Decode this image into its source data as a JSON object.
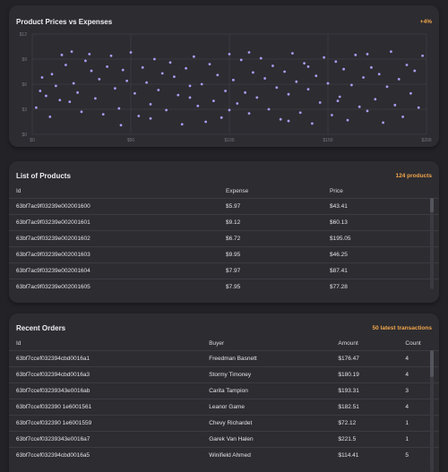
{
  "chart_card": {
    "title": "Product Prices vs Expenses",
    "badge": "+4%"
  },
  "chart_data": {
    "type": "scatter",
    "title": "Product Prices vs Expenses",
    "xlabel": "",
    "ylabel": "",
    "xlim": [
      0,
      200
    ],
    "ylim": [
      0,
      12
    ],
    "x_ticks": [
      "$0",
      "$50",
      "$100",
      "$150",
      "$200"
    ],
    "y_ticks": [
      "$0",
      "$3",
      "$6",
      "$9",
      "$12"
    ],
    "point_color": "#a99cf0",
    "grid": true,
    "points": [
      [
        2,
        3.2
      ],
      [
        4,
        5.2
      ],
      [
        5,
        6.8
      ],
      [
        7,
        4.6
      ],
      [
        9,
        2.1
      ],
      [
        10,
        7.2
      ],
      [
        12,
        5.8
      ],
      [
        14,
        4.1
      ],
      [
        15,
        9.5
      ],
      [
        17,
        8.3
      ],
      [
        19,
        3.9
      ],
      [
        21,
        6.1
      ],
      [
        23,
        5.0
      ],
      [
        25,
        2.7
      ],
      [
        27,
        8.8
      ],
      [
        29,
        9.6
      ],
      [
        30,
        7.6
      ],
      [
        32,
        4.3
      ],
      [
        34,
        6.6
      ],
      [
        36,
        2.4
      ],
      [
        38,
        8.1
      ],
      [
        40,
        9.4
      ],
      [
        42,
        5.5
      ],
      [
        44,
        3.1
      ],
      [
        46,
        7.7
      ],
      [
        48,
        6.4
      ],
      [
        50,
        9.8
      ],
      [
        52,
        4.9
      ],
      [
        54,
        2.2
      ],
      [
        56,
        8.0
      ],
      [
        58,
        6.2
      ],
      [
        60,
        3.6
      ],
      [
        62,
        9.0
      ],
      [
        64,
        5.3
      ],
      [
        66,
        7.3
      ],
      [
        68,
        2.9
      ],
      [
        70,
        8.6
      ],
      [
        72,
        6.9
      ],
      [
        74,
        4.7
      ],
      [
        76,
        1.2
      ],
      [
        78,
        7.9
      ],
      [
        80,
        5.8
      ],
      [
        82,
        9.3
      ],
      [
        84,
        3.4
      ],
      [
        86,
        6.0
      ],
      [
        88,
        1.5
      ],
      [
        90,
        8.4
      ],
      [
        92,
        4.0
      ],
      [
        94,
        7.1
      ],
      [
        96,
        2.0
      ],
      [
        98,
        5.2
      ],
      [
        100,
        9.6
      ],
      [
        102,
        6.5
      ],
      [
        104,
        3.7
      ],
      [
        106,
        8.9
      ],
      [
        108,
        5.0
      ],
      [
        110,
        2.5
      ],
      [
        112,
        7.4
      ],
      [
        114,
        4.4
      ],
      [
        116,
        9.1
      ],
      [
        118,
        6.7
      ],
      [
        120,
        3.0
      ],
      [
        122,
        8.2
      ],
      [
        124,
        5.6
      ],
      [
        126,
        1.8
      ],
      [
        128,
        7.5
      ],
      [
        130,
        4.8
      ],
      [
        132,
        9.7
      ],
      [
        134,
        6.3
      ],
      [
        136,
        2.6
      ],
      [
        138,
        8.5
      ],
      [
        140,
        5.4
      ],
      [
        142,
        1.3
      ],
      [
        144,
        7.0
      ],
      [
        146,
        3.8
      ],
      [
        148,
        9.2
      ],
      [
        150,
        6.1
      ],
      [
        152,
        2.3
      ],
      [
        154,
        8.7
      ],
      [
        156,
        4.5
      ],
      [
        158,
        7.8
      ],
      [
        160,
        1.7
      ],
      [
        162,
        5.9
      ],
      [
        164,
        9.5
      ],
      [
        166,
        3.3
      ],
      [
        168,
        6.8
      ],
      [
        170,
        2.8
      ],
      [
        172,
        8.0
      ],
      [
        174,
        4.2
      ],
      [
        176,
        7.2
      ],
      [
        178,
        1.4
      ],
      [
        180,
        5.7
      ],
      [
        182,
        9.9
      ],
      [
        184,
        3.5
      ],
      [
        186,
        6.6
      ],
      [
        188,
        2.1
      ],
      [
        190,
        8.3
      ],
      [
        192,
        4.9
      ],
      [
        194,
        7.6
      ],
      [
        196,
        3.2
      ],
      [
        198,
        9.4
      ],
      [
        20,
        9.9
      ],
      [
        60,
        1.9
      ],
      [
        110,
        9.8
      ],
      [
        130,
        1.6
      ],
      [
        170,
        9.6
      ],
      [
        80,
        4.4
      ],
      [
        140,
        8.1
      ],
      [
        100,
        2.9
      ],
      [
        45,
        1.1
      ],
      [
        155,
        4.0
      ]
    ]
  },
  "products": {
    "title": "List of Products",
    "badge": "124 products",
    "columns": [
      "Id",
      "Expense",
      "Price"
    ],
    "rows": [
      [
        "63bf7ac9f03239e002001600",
        "$5.97",
        "$43.41"
      ],
      [
        "63bf7ac9f03239e002001601",
        "$9.12",
        "$60.13"
      ],
      [
        "63bf7ac9f03239e002001602",
        "$6.72",
        "$195.05"
      ],
      [
        "63bf7ac9f03239e002001603",
        "$9.95",
        "$46.25"
      ],
      [
        "63bf7ac9f03239e002001604",
        "$7.97",
        "$87.41"
      ],
      [
        "63bf7ac9f03239e002001605",
        "$7.95",
        "$77.28"
      ]
    ]
  },
  "orders": {
    "title": "Recent Orders",
    "badge": "50 latest transactions",
    "columns": [
      "Id",
      "Buyer",
      "Amount",
      "Count"
    ],
    "rows": [
      [
        "63bf7ccef032394cbd0016a1",
        "Freedman Basnett",
        "$176.47",
        "4"
      ],
      [
        "63bf7ccef032394cbd0016a3",
        "Stormy Timoney",
        "$180.19",
        "4"
      ],
      [
        "63bf7ccef03239343e0016ab",
        "Carita Tampion",
        "$193.31",
        "3"
      ],
      [
        "63bf7ccef032390 1e6001561",
        "Leanor Game",
        "$182.51",
        "4"
      ],
      [
        "63bf7ccef032390 1e6001559",
        "Chevy Richardet",
        "$72.12",
        "1"
      ],
      [
        "63bf7ccef03239343e0016a7",
        "Garek Van Halen",
        "$221.5",
        "1"
      ],
      [
        "63bf7ccef032394cbd0016a5",
        "Winifield Ahmed",
        "$114.41",
        "5"
      ]
    ]
  }
}
